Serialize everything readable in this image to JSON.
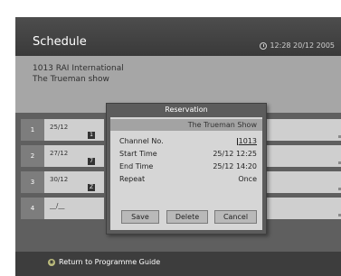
{
  "header": {
    "title": "Schedule",
    "clock_icon": "clock-icon",
    "datetime": "12:28 20/12 2005"
  },
  "info": {
    "channel": "1013 RAI International",
    "show": "The Trueman show"
  },
  "schedule": {
    "rows": [
      {
        "num": "1",
        "date": "25/12",
        "mode_icon": "once-icon"
      },
      {
        "num": "2",
        "date": "27/12",
        "mode_icon": "daily-icon"
      },
      {
        "num": "3",
        "date": "30/12",
        "mode_icon": "weekly-icon"
      },
      {
        "num": "4",
        "date": "__/__",
        "mode_icon": ""
      }
    ]
  },
  "footer": {
    "button_icon": "remote-button-icon",
    "text": "Return to Programme Guide"
  },
  "dialog": {
    "title": "Reservation",
    "show_name": "The Trueman Show",
    "fields": [
      {
        "label": "Channel No.",
        "value": "1013"
      },
      {
        "label": "Start Time",
        "value": "25/12 12:25"
      },
      {
        "label": "End Time",
        "value": "25/12 14:20"
      },
      {
        "label": "Repeat",
        "value": "Once"
      }
    ],
    "buttons": {
      "save": "Save",
      "delete": "Delete",
      "cancel": "Cancel"
    }
  }
}
